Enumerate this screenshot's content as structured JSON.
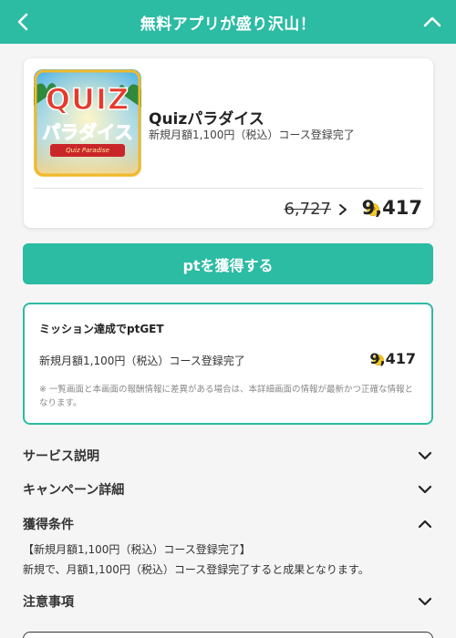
{
  "header": {
    "title": "無料アプリが盛り沢山！",
    "back_icon": "chevron-left-icon",
    "collapse_icon": "chevron-up-icon"
  },
  "app": {
    "name": "Quizパラダイス",
    "description": "新規月額1,100円（税込）コース登録完了",
    "logo_text_1": "QUIZ",
    "logo_text_2": "パラダイス",
    "logo_text_3": "Quiz Paradise",
    "old_points": "6,727",
    "new_points": "9,417"
  },
  "get_button": {
    "label": "ptを獲得する"
  },
  "mission": {
    "title": "ミッション達成でptGET",
    "task": "新規月額1,100円（税込）コース登録完了",
    "points": "9,417",
    "note": "※ 一覧画面と本画面の報酬情報に差異がある場合は、本詳細画面の情報が最新かつ正確な情報となります。"
  },
  "accordion": {
    "service": "サービス説明",
    "campaign": "キャンペーン詳細",
    "conditions": "獲得条件",
    "conditions_line1": "【新規月額1,100円（税込）コース登録完了】",
    "conditions_line2": "新規で、月額1,100円（税込）コース登録完了すると成果となります。",
    "notes": "注意事項"
  },
  "colors": {
    "accent": "#2cbba3",
    "coin": "#f4cc2b"
  }
}
